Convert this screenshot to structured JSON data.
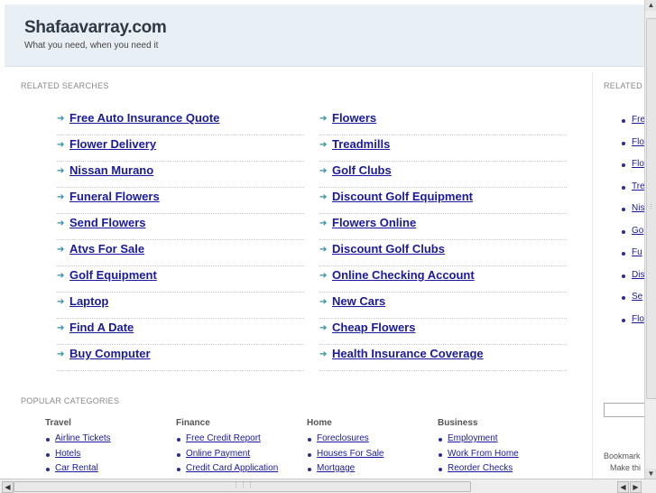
{
  "header": {
    "title": "Shafaavarray.com",
    "tagline": "What you need, when you need it"
  },
  "related": {
    "label": "RELATED SEARCHES",
    "left": [
      "Free Auto Insurance Quote",
      "Flower Delivery",
      "Nissan Murano",
      "Funeral Flowers",
      "Send Flowers",
      "Atvs For Sale",
      "Golf Equipment",
      "Laptop",
      "Find A Date",
      "Buy Computer"
    ],
    "right": [
      "Flowers",
      "Treadmills",
      "Golf Clubs",
      "Discount Golf Equipment",
      "Flowers Online",
      "Discount Golf Clubs",
      "Online Checking Account",
      "New Cars",
      "Cheap Flowers",
      "Health Insurance Coverage"
    ]
  },
  "popular": {
    "label": "POPULAR CATEGORIES",
    "columns": [
      {
        "title": "Travel",
        "items": [
          "Airline Tickets",
          "Hotels",
          "Car Rental"
        ]
      },
      {
        "title": "Finance",
        "items": [
          "Free Credit Report",
          "Online Payment",
          "Credit Card Application"
        ]
      },
      {
        "title": "Home",
        "items": [
          "Foreclosures",
          "Houses For Sale",
          "Mortgage"
        ]
      },
      {
        "title": "Business",
        "items": [
          "Employment",
          "Work From Home",
          "Reorder Checks"
        ]
      }
    ]
  },
  "sidebar": {
    "label": "RELATED",
    "items": [
      "Fre",
      "Flo",
      "Flo",
      "Tre",
      "Nis",
      "Go",
      "Fu",
      "Dis",
      "Se",
      "Flo"
    ],
    "bookmark": "Bookmark",
    "make": "Make thi"
  },
  "colors": {
    "link": "#1a1a9e",
    "arrow": "#2a8fa0",
    "header_bg": "#e8f0f6"
  },
  "icons": {
    "arrow": "arrow-right-icon",
    "scroll_left": "scroll-left-icon",
    "scroll_right": "scroll-right-icon"
  }
}
